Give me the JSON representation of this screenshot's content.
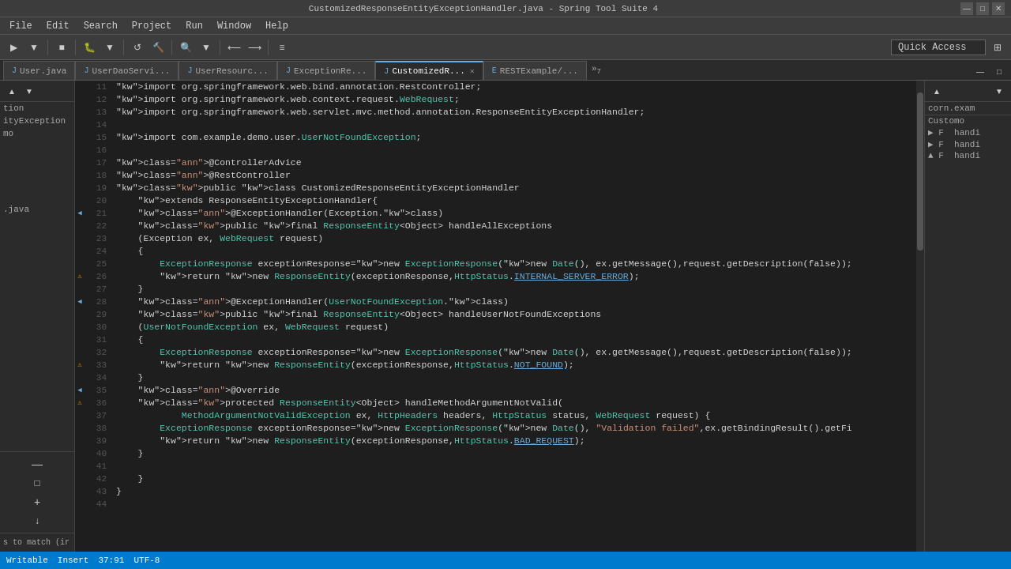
{
  "titlebar": {
    "title": "CustomizedResponseEntityExceptionHandler.java - Spring Tool Suite 4",
    "controls": [
      "—",
      "□",
      "✕"
    ]
  },
  "menubar": {
    "items": [
      "File",
      "Edit",
      "Search",
      "Project",
      "Run",
      "Window",
      "Help"
    ]
  },
  "toolbar": {
    "quick_access_placeholder": "Quick Access"
  },
  "tabs": [
    {
      "label": "User.java",
      "icon": "J",
      "active": false,
      "closeable": false
    },
    {
      "label": "UserDaoServi...",
      "icon": "J",
      "active": false,
      "closeable": false
    },
    {
      "label": "UserResourc...",
      "icon": "J",
      "active": false,
      "closeable": false
    },
    {
      "label": "ExceptionRe...",
      "icon": "J",
      "active": false,
      "closeable": false
    },
    {
      "label": "CustomizedR...",
      "icon": "J",
      "active": true,
      "closeable": true
    },
    {
      "label": "RESTExample/...",
      "icon": "E",
      "active": false,
      "closeable": false
    }
  ],
  "tab_overflow": "»₇",
  "code": {
    "lines": [
      {
        "num": 11,
        "content": "import org.springframework.web.bind.annotation.RestController;",
        "marker": ""
      },
      {
        "num": 12,
        "content": "import org.springframework.web.context.request.WebRequest;",
        "marker": ""
      },
      {
        "num": 13,
        "content": "import org.springframework.web.servlet.mvc.method.annotation.ResponseEntityExceptionHandler;",
        "marker": ""
      },
      {
        "num": 14,
        "content": "",
        "marker": ""
      },
      {
        "num": 15,
        "content": "import com.example.demo.user.UserNotFoundException;",
        "marker": ""
      },
      {
        "num": 16,
        "content": "",
        "marker": ""
      },
      {
        "num": 17,
        "content": "@ControllerAdvice",
        "marker": ""
      },
      {
        "num": 18,
        "content": "@RestController",
        "marker": ""
      },
      {
        "num": 19,
        "content": "public class CustomizedResponseEntityExceptionHandler",
        "marker": ""
      },
      {
        "num": 20,
        "content": "    extends ResponseEntityExceptionHandler{",
        "marker": ""
      },
      {
        "num": 21,
        "content": "    @ExceptionHandler(Exception.class)",
        "marker": "◀"
      },
      {
        "num": 22,
        "content": "    public final ResponseEntity<Object> handleAllExceptions",
        "marker": ""
      },
      {
        "num": 23,
        "content": "    (Exception ex, WebRequest request)",
        "marker": ""
      },
      {
        "num": 24,
        "content": "    {",
        "marker": ""
      },
      {
        "num": 25,
        "content": "        ExceptionResponse exceptionResponse=new ExceptionResponse(new Date(), ex.getMessage(),request.getDescription(false));",
        "marker": ""
      },
      {
        "num": 26,
        "content": "        return new ResponseEntity(exceptionResponse,HttpStatus.INTERNAL_SERVER_ERROR);",
        "marker": "⚠"
      },
      {
        "num": 27,
        "content": "    }",
        "marker": ""
      },
      {
        "num": 28,
        "content": "    @ExceptionHandler(UserNotFoundException.class)",
        "marker": "◀"
      },
      {
        "num": 29,
        "content": "    public final ResponseEntity<Object> handleUserNotFoundExceptions",
        "marker": ""
      },
      {
        "num": 30,
        "content": "    (UserNotFoundException ex, WebRequest request)",
        "marker": ""
      },
      {
        "num": 31,
        "content": "    {",
        "marker": ""
      },
      {
        "num": 32,
        "content": "        ExceptionResponse exceptionResponse=new ExceptionResponse(new Date(), ex.getMessage(),request.getDescription(false));",
        "marker": ""
      },
      {
        "num": 33,
        "content": "        return new ResponseEntity(exceptionResponse,HttpStatus.NOT_FOUND);",
        "marker": "⚠"
      },
      {
        "num": 34,
        "content": "    }",
        "marker": ""
      },
      {
        "num": 35,
        "content": "    @Override",
        "marker": "◀"
      },
      {
        "num": 36,
        "content": "    protected ResponseEntity<Object> handleMethodArgumentNotValid(",
        "marker": "⚠"
      },
      {
        "num": 37,
        "content": "            MethodArgumentNotValidException ex, HttpHeaders headers, HttpStatus status, WebRequest request) {",
        "marker": ""
      },
      {
        "num": 38,
        "content": "        ExceptionResponse exceptionResponse=new ExceptionResponse(new Date(), \"Validation failed\",ex.getBindingResult().getFi",
        "marker": ""
      },
      {
        "num": 39,
        "content": "        return new ResponseEntity(exceptionResponse,HttpStatus.BAD_REQUEST);",
        "marker": ""
      },
      {
        "num": 40,
        "content": "    }",
        "marker": ""
      },
      {
        "num": 41,
        "content": "",
        "marker": ""
      },
      {
        "num": 42,
        "content": "    }",
        "marker": ""
      },
      {
        "num": 43,
        "content": "}",
        "marker": ""
      },
      {
        "num": 44,
        "content": "",
        "marker": ""
      }
    ]
  },
  "left_panel": {
    "items": [
      "tion",
      "ityException",
      "mo",
      "",
      ".java",
      ""
    ]
  },
  "right_outline": {
    "header": "corn.exam",
    "items": [
      "Customo",
      "▶ F  handi",
      "▶ F  handi",
      "▲ F  handi"
    ]
  },
  "statusbar": {
    "match_label": "s to match (ir"
  },
  "bottom_controls": {
    "collapse": "—",
    "expand": "□",
    "add": "+",
    "down": "↓"
  }
}
